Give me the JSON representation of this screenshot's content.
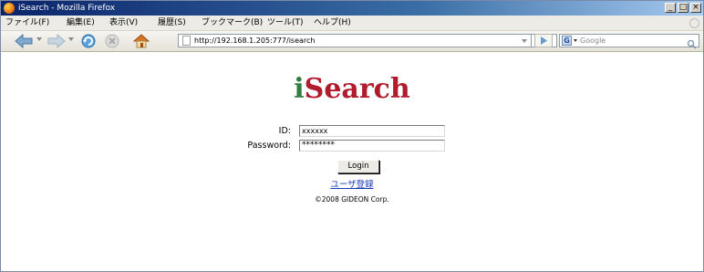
{
  "window": {
    "title": "iSearch - Mozilla Firefox",
    "controls": [
      "_",
      "□",
      "×"
    ]
  },
  "menu": {
    "items": [
      "ファイル(F)",
      "編集(E)",
      "表示(V)",
      "履歴(S)",
      "ブックマーク(B)",
      "ツール(T)",
      "ヘルプ(H)"
    ]
  },
  "navigation": {
    "icons": [
      "back-arrow-icon",
      "forward-arrow-icon",
      "reload-icon",
      "stop-icon",
      "home-icon"
    ],
    "url": "http://192.168.1.205:777/isearch",
    "search_engine_letter": "G",
    "search_placeholder": "Google"
  },
  "page": {
    "logo": {
      "first_letter": "i",
      "rest": "Search"
    },
    "id_label": "ID:",
    "id_value": "xxxxxx",
    "password_label": "Password:",
    "password_value": "********",
    "login_label": "Login",
    "register_link": "ユーザ登録",
    "copyright": "©2008 GIDEON Corp."
  },
  "colors": {
    "logo_i": "#2e7d3e",
    "logo_rest": "#b01c2e",
    "link": "#1a3cb8",
    "titlebar_start": "#0a246a"
  }
}
